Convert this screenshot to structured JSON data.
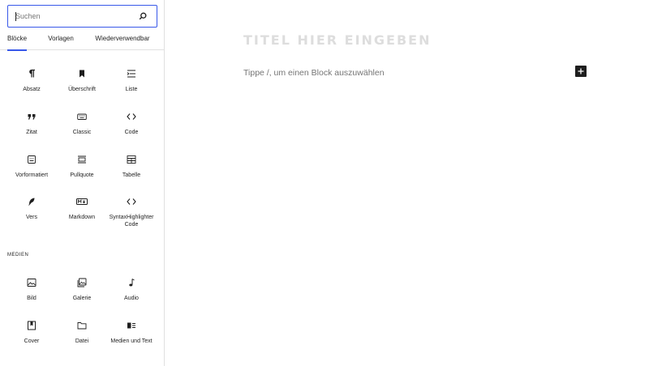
{
  "sidebar": {
    "search": {
      "placeholder": "Suchen",
      "value": ""
    },
    "tabs": [
      {
        "label": "Blöcke",
        "active": true
      },
      {
        "label": "Vorlagen",
        "active": false
      },
      {
        "label": "Wiederverwendbar",
        "active": false
      }
    ],
    "blocks": [
      {
        "label": "Absatz",
        "icon": "paragraph-icon"
      },
      {
        "label": "Überschrift",
        "icon": "heading-bookmark-icon"
      },
      {
        "label": "Liste",
        "icon": "list-icon"
      },
      {
        "label": "Zitat",
        "icon": "quote-icon"
      },
      {
        "label": "Classic",
        "icon": "keyboard-icon"
      },
      {
        "label": "Code",
        "icon": "code-icon"
      },
      {
        "label": "Vorformatiert",
        "icon": "preformatted-icon"
      },
      {
        "label": "Pullquote",
        "icon": "pullquote-icon"
      },
      {
        "label": "Tabelle",
        "icon": "table-icon"
      },
      {
        "label": "Vers",
        "icon": "feather-icon"
      },
      {
        "label": "Markdown",
        "icon": "markdown-icon"
      },
      {
        "label": "SyntaxHighlighter Code",
        "icon": "code-icon"
      }
    ],
    "media_section_label": "MEDIEN",
    "media_blocks": [
      {
        "label": "Bild",
        "icon": "image-icon"
      },
      {
        "label": "Galerie",
        "icon": "gallery-icon"
      },
      {
        "label": "Audio",
        "icon": "music-note-icon"
      },
      {
        "label": "Cover",
        "icon": "cover-icon"
      },
      {
        "label": "Datei",
        "icon": "folder-icon"
      },
      {
        "label": "Medien und Text",
        "icon": "media-text-icon"
      }
    ]
  },
  "editor": {
    "title_placeholder": "TITEL HIER EINGEBEN",
    "block_prompt": "Tippe /, um einen Block auszuwählen",
    "add_block_icon": "plus-icon"
  },
  "colors": {
    "accent": "#3858e9",
    "text": "#1e1e1e",
    "muted": "#757575",
    "title_placeholder": "#dddddd",
    "border": "#e0e0e0"
  }
}
